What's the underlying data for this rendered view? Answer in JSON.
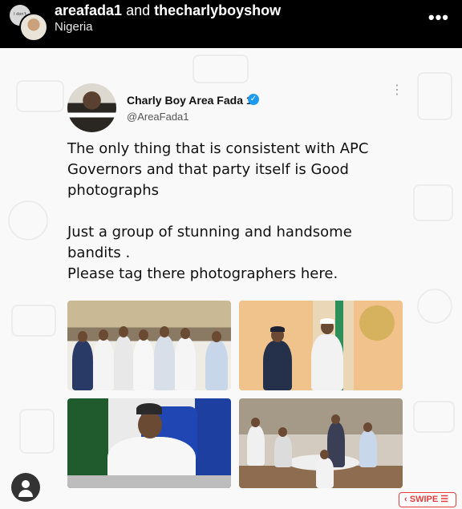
{
  "header": {
    "account_primary": "areafada1",
    "conjunction": "and",
    "account_secondary": "thecharlyboyshow",
    "location": "Nigeria",
    "more_glyph": "•••",
    "icons": [
      "avatar",
      "more-options-icon"
    ]
  },
  "tweet": {
    "author_name": "Charly Boy Area Fada 1",
    "handle": "@AreaFada1",
    "verified_glyph": "✓",
    "more_glyph": "⋮",
    "text_lines_1": [
      "The only thing that is consistent with APC",
      "Governors and that party itself is Good",
      "photographs"
    ],
    "text_lines_2": [
      "Just a group of stunning and handsome",
      "bandits .",
      "Please tag there photographers here."
    ],
    "photos": [
      "group-photo",
      "greeting-photo",
      "desk-photo",
      "meeting-photo"
    ]
  },
  "overlay": {
    "swipe_label": "SWIPE",
    "swipe_arrow": "‹",
    "swipe_lines": "☰"
  },
  "colors": {
    "header_bg": "#000000",
    "verified": "#1d9bf0",
    "swipe": "#e43b3b"
  }
}
